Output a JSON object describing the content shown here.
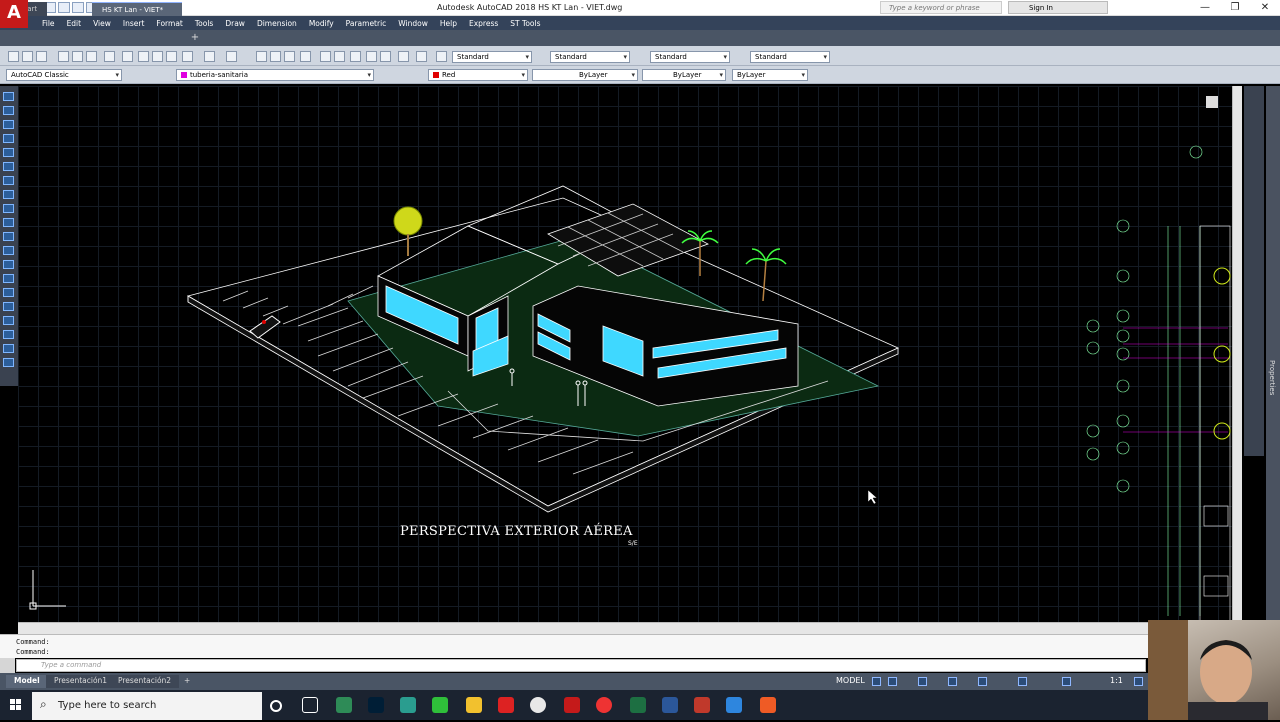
{
  "window": {
    "app_title": "Autodesk AutoCAD 2018    HS KT Lan - VIET.dwg",
    "search_placeholder": "Type a keyword or phrase",
    "signin_label": "Sign In",
    "minimize": "—",
    "restore": "❐",
    "close": "✕"
  },
  "logo": {
    "letter": "A"
  },
  "menubar": {
    "items": [
      "File",
      "Edit",
      "View",
      "Insert",
      "Format",
      "Tools",
      "Draw",
      "Dimension",
      "Modify",
      "Parametric",
      "Window",
      "Help",
      "Express",
      "ST Tools"
    ]
  },
  "doc_tabs": {
    "start": "Start",
    "drawing": "HS KT Lan - VIET*",
    "add": "+"
  },
  "toolbar1": {
    "text_style": "Standard",
    "dim_style": "Standard",
    "table_style": "Standard",
    "mleader_style": "Standard"
  },
  "toolbar2": {
    "workspace": "AutoCAD Classic",
    "layer": "tuberia-sanitaria",
    "color": "Red",
    "linetype": "ByLayer",
    "lineweight": "ByLayer",
    "plotstyle": "ByLayer"
  },
  "colors": {
    "layer_magenta": "#e000e0",
    "color_red": "#e00000",
    "cyan_glass": "#3fd8ff"
  },
  "drawing": {
    "title": "PERSPECTIVA EXTERIOR AÉREA",
    "scale": "S/E"
  },
  "command": {
    "history_1": "Command:",
    "history_2": "Command:",
    "placeholder": "Type a command"
  },
  "layout_tabs": {
    "model": "Model",
    "pres1": "Presentación1",
    "pres2": "Presentación2",
    "add": "+"
  },
  "status": {
    "model": "MODEL",
    "scale": "1:1"
  },
  "palette": {
    "properties": "Properties"
  },
  "taskbar": {
    "search_placeholder": "Type here to search"
  }
}
